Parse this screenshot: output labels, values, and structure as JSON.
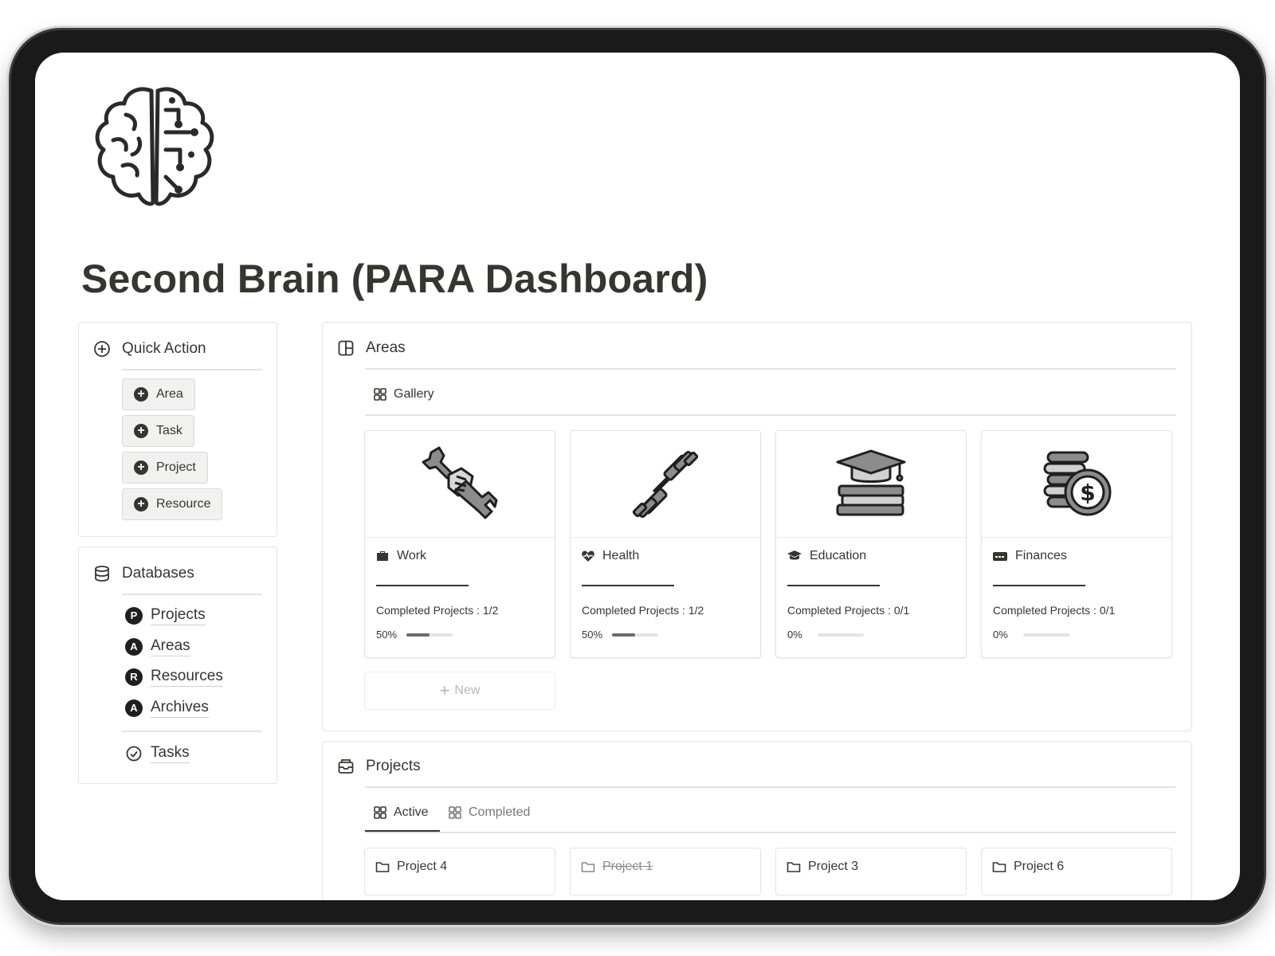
{
  "page": {
    "title": "Second Brain (PARA Dashboard)",
    "icon": "brain-circuit-icon"
  },
  "quick_action": {
    "heading": "Quick Action",
    "icon": "plus-circle-icon",
    "buttons": [
      {
        "label": "Area"
      },
      {
        "label": "Task"
      },
      {
        "label": "Project"
      },
      {
        "label": "Resource"
      }
    ]
  },
  "databases": {
    "heading": "Databases",
    "icon": "database-icon",
    "items": [
      {
        "badge": "P",
        "label": "Projects"
      },
      {
        "badge": "A",
        "label": "Areas"
      },
      {
        "badge": "R",
        "label": "Resources"
      },
      {
        "badge": "A",
        "label": "Archives"
      }
    ],
    "tasks": {
      "label": "Tasks",
      "icon": "check-circle-icon"
    }
  },
  "areas": {
    "heading": "Areas",
    "icon": "layout-icon",
    "view_tab": "Gallery",
    "new_label": "New",
    "cards": [
      {
        "title": "Work",
        "icon": "briefcase-icon",
        "cover": "wrench-hand-icon",
        "stat": "Completed Projects : 1/2",
        "pct_label": "50%",
        "progress": 0.5
      },
      {
        "title": "Health",
        "icon": "heart-pulse-icon",
        "cover": "dumbbell-icon",
        "stat": "Completed Projects : 1/2",
        "pct_label": "50%",
        "progress": 0.5
      },
      {
        "title": "Education",
        "icon": "graduation-cap-icon",
        "cover": "books-cap-icon",
        "stat": "Completed Projects : 0/1",
        "pct_label": "0%",
        "progress": 0
      },
      {
        "title": "Finances",
        "icon": "card-icon",
        "cover": "coins-dollar-icon",
        "stat": "Completed Projects : 0/1",
        "pct_label": "0%",
        "progress": 0
      }
    ]
  },
  "projects": {
    "heading": "Projects",
    "icon": "inbox-tray-icon",
    "tabs": [
      {
        "label": "Active",
        "active": true
      },
      {
        "label": "Completed",
        "active": false
      }
    ],
    "cards": [
      {
        "title": "Project 4",
        "struck": false
      },
      {
        "title": "Project 1",
        "struck": true
      },
      {
        "title": "Project 3",
        "struck": false
      },
      {
        "title": "Project 6",
        "struck": false
      }
    ]
  },
  "colors": {
    "text": "#37352f",
    "border": "#e3e3e1",
    "button_bg": "#f1f1ef",
    "progress_fill": "#6b6b6b",
    "frame": "#1a1a1a"
  }
}
